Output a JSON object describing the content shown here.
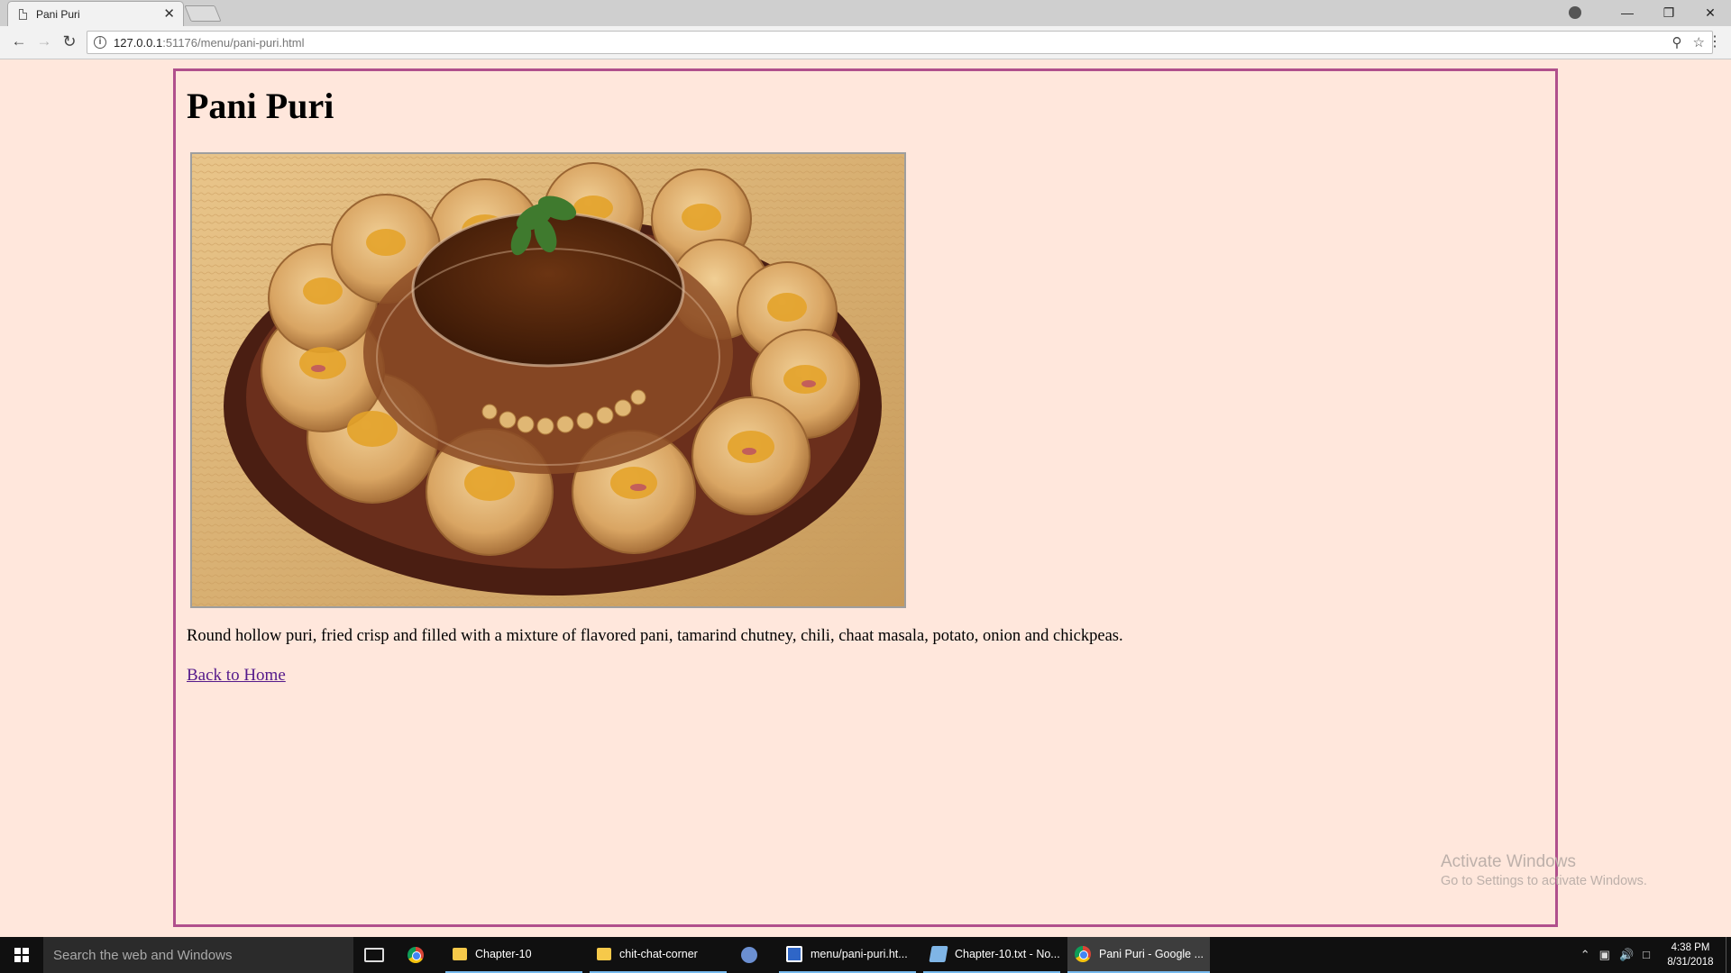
{
  "browser": {
    "tab_title": "Pani Puri",
    "tab_close": "✕",
    "url_host": "127.0.0.1",
    "url_rest": ":51176/menu/pani-puri.html",
    "window_controls": {
      "minimize": "—",
      "restore": "❐",
      "close": "✕"
    }
  },
  "page": {
    "heading": "Pani Puri",
    "image_alt": "Plate of pani puri with tamarind water bowl",
    "description": "Round hollow puri, fried crisp and filled with a mixture of flavored pani, tamarind chutney, chili, chaat masala, potato, onion and chickpeas.",
    "back_link": "Back to Home"
  },
  "watermark": {
    "line1": "Activate Windows",
    "line2": "Go to Settings to activate Windows."
  },
  "taskbar": {
    "search_placeholder": "Search the web and Windows",
    "items": [
      {
        "label": "",
        "icon": "chrome-icon"
      },
      {
        "label": "Chapter-10",
        "icon": "folder-icon"
      },
      {
        "label": "chit-chat-corner",
        "icon": "folder-icon"
      },
      {
        "label": "",
        "icon": "paint-icon"
      },
      {
        "label": "menu/pani-puri.ht...",
        "icon": "brackets-icon"
      },
      {
        "label": "Chapter-10.txt - No...",
        "icon": "notepad-icon"
      },
      {
        "label": "Pani Puri - Google ...",
        "icon": "chrome-icon"
      }
    ],
    "time": "4:38 PM",
    "date": "8/31/2018"
  },
  "colors": {
    "page_background": "#ffe7dc",
    "content_border": "#b0508c",
    "link_visited": "#551a8b",
    "taskbar": "#101010"
  }
}
